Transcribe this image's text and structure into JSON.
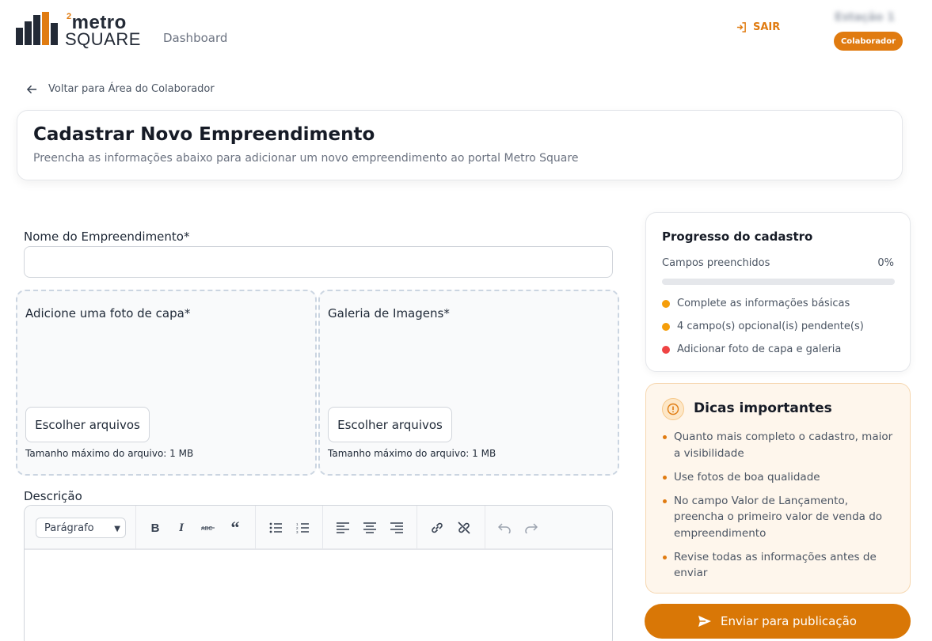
{
  "header": {
    "logo_superscript": "2",
    "logo_top": "metro",
    "logo_bottom": "SQUARE",
    "nav_dashboard": "Dashboard",
    "logout_label": "SAIR",
    "station_name": "Estação 1",
    "role_badge": "Colaborador"
  },
  "back_link": "Voltar para Área do Colaborador",
  "page": {
    "title": "Cadastrar Novo Empreendimento",
    "subtitle": "Preencha as informações abaixo para adicionar um novo empreendimento ao portal Metro Square"
  },
  "form": {
    "name_label": "Nome do Empreendimento*",
    "name_value": "",
    "cover": {
      "title": "Adicione uma foto de capa*",
      "button": "Escolher arquivos",
      "hint": "Tamanho máximo do arquivo: 1 MB"
    },
    "gallery": {
      "title": "Galeria de Imagens*",
      "button": "Escolher arquivos",
      "hint": "Tamanho máximo do arquivo: 1 MB"
    },
    "description_label": "Descrição",
    "editor": {
      "paragraph_select": "Parágrafo",
      "tools": [
        "bold-icon",
        "italic-icon",
        "strikethrough-icon",
        "quote-icon",
        "bullet-list-icon",
        "numbered-list-icon",
        "align-left-icon",
        "align-center-icon",
        "align-right-icon",
        "link-icon",
        "unlink-icon",
        "undo-icon",
        "redo-icon"
      ]
    }
  },
  "progress": {
    "title": "Progresso do cadastro",
    "fields_label": "Campos preenchidos",
    "percent_text": "0%",
    "percent_value": 0,
    "items": [
      {
        "text": "Complete as informações básicas",
        "color": "#f59e0b"
      },
      {
        "text": "4 campo(s) opcional(is) pendente(s)",
        "color": "#f59e0b"
      },
      {
        "text": "Adicionar foto de capa e galeria",
        "color": "#ef4444"
      }
    ]
  },
  "tips": {
    "title": "Dicas importantes",
    "items": [
      "Quanto mais completo o cadastro, maior a visibilidade",
      "Use fotos de boa qualidade",
      "No campo Valor de Lançamento, preencha o primeiro valor de venda do empreendimento",
      "Revise todas as informações antes de enviar"
    ]
  },
  "submit_label": "Enviar para publicação",
  "colors": {
    "accent": "#e07b10",
    "logo_bar_dark": "#232a36",
    "logo_bar_orange": "#e07b10"
  }
}
